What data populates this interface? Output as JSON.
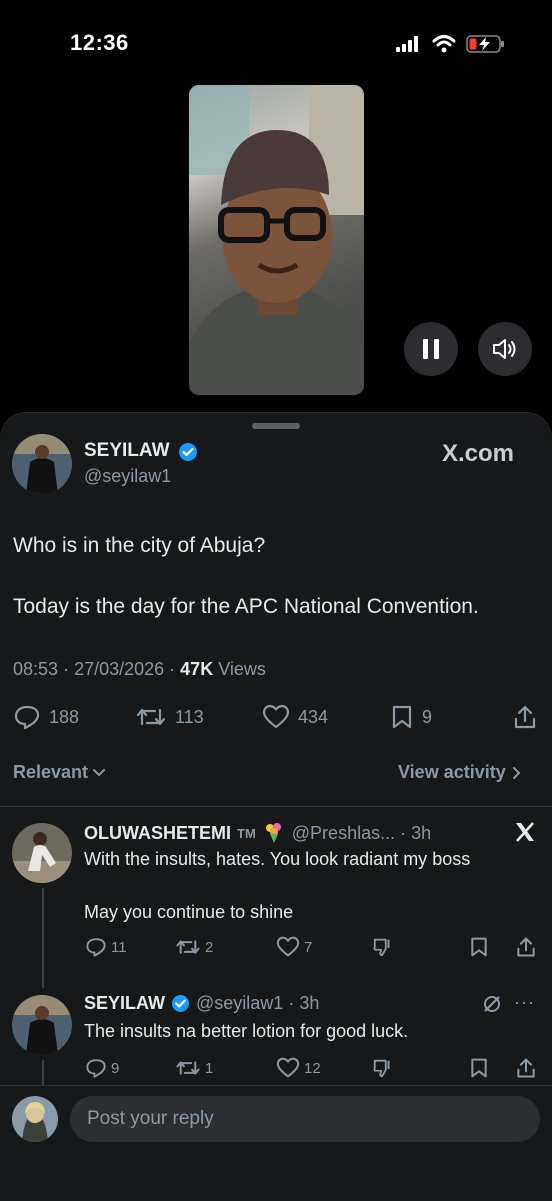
{
  "status": {
    "time": "12:36"
  },
  "tweet": {
    "author_name": "SEYILAW",
    "author_handle": "@seyilaw1",
    "source_logo": "X.com",
    "text_line1": "Who is in the city of Abuja?",
    "text_line2": "Today is the day for the APC National Convention.",
    "time": "08:53",
    "date": "27/03/2026",
    "views_count": "47K",
    "views_label": "Views",
    "replies": "188",
    "reposts": "113",
    "likes": "434",
    "bookmarks": "9"
  },
  "filter": {
    "label": "Relevant",
    "view_activity": "View activity"
  },
  "replies": [
    {
      "name": "OLUWASHETEMI",
      "tm": "TM",
      "handle_time": "@Preshlas... · 3h",
      "line1": "With the insults, hates. You look radiant my boss",
      "line2": "May you continue to shine",
      "replies": "11",
      "reposts": "2",
      "likes": "7"
    },
    {
      "name": "SEYILAW",
      "handle_time": "@seyilaw1 · 3h",
      "line1": "The insults na better lotion for good luck.",
      "replies": "9",
      "reposts": "1",
      "likes": "12"
    }
  ],
  "composer": {
    "placeholder": "Post your reply"
  },
  "colors": {
    "background": "#000000",
    "sheet": "#16181a",
    "text": "#e7e9ea",
    "muted": "#8b98a5",
    "verified": "#1d9bf0",
    "battery_low": "#ff3b30"
  }
}
